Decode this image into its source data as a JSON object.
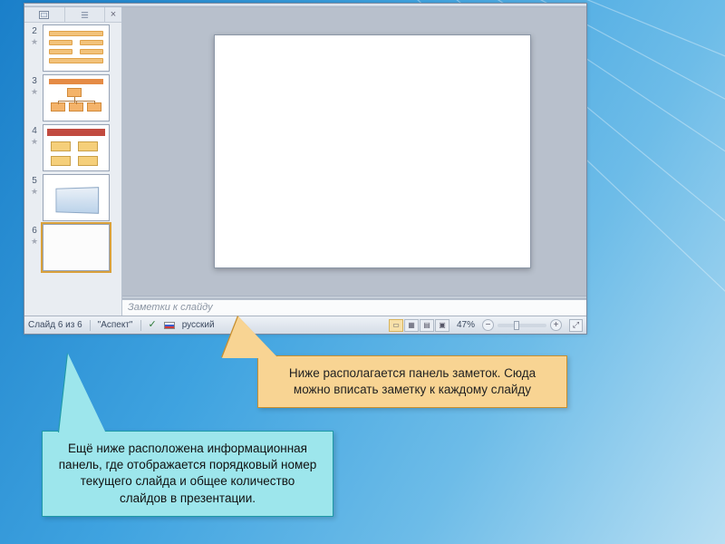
{
  "sidebar": {
    "close_glyph": "×",
    "thumbs": [
      {
        "num": "2"
      },
      {
        "num": "3"
      },
      {
        "num": "4"
      },
      {
        "num": "5"
      },
      {
        "num": "6"
      }
    ]
  },
  "notes": {
    "placeholder": "Заметки к слайду"
  },
  "status": {
    "slide_info": "Слайд 6 из 6",
    "theme": "\"Аспект\"",
    "language": "русский",
    "zoom_label": "47%",
    "zoom_minus": "−",
    "zoom_plus": "+",
    "fit_glyph": "⤢"
  },
  "view_buttons": {
    "normal": "▭",
    "sorter": "▦",
    "reading": "▤",
    "show": "▣"
  },
  "callouts": {
    "orange": "Ниже располагается панель заметок. Сюда можно вписать заметку к каждому слайду",
    "cyan": "Ещё ниже расположена информационная панель, где отображается порядковый номер текущего слайда и общее количество слайдов в презентации."
  }
}
